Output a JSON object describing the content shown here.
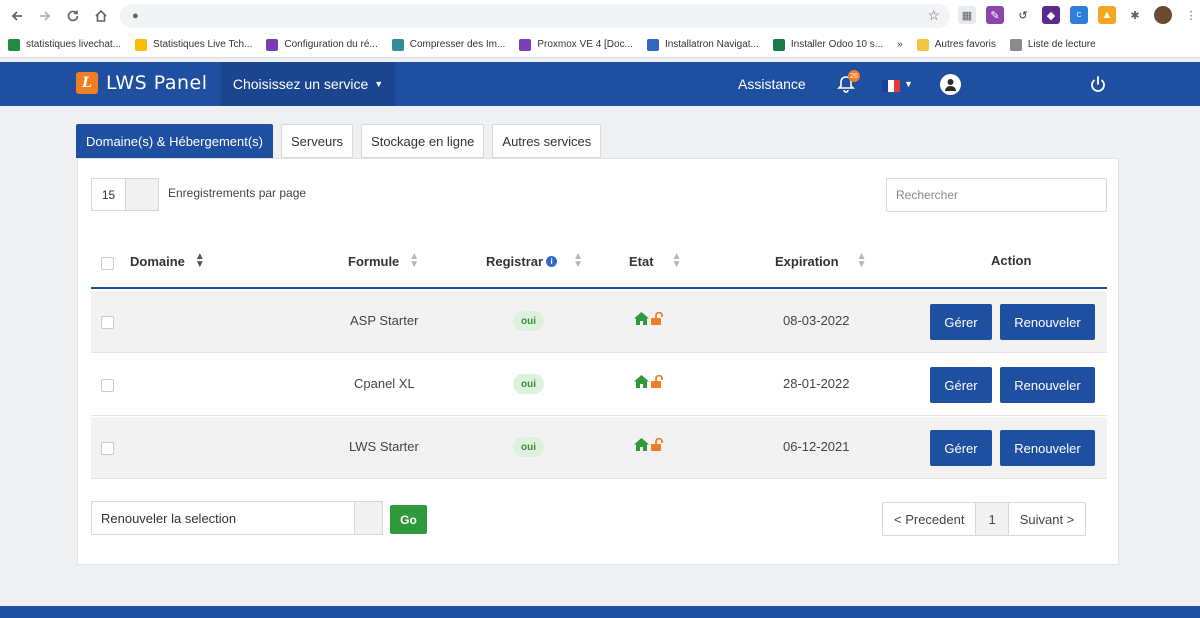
{
  "browser": {
    "bookmarks": [
      {
        "label": "statistiques livechat...",
        "color": "#1e8e3e"
      },
      {
        "label": "Statistiques Live Tch...",
        "color": "#fbbc04"
      },
      {
        "label": "Configuration du ré...",
        "color": "#7b3fb5"
      },
      {
        "label": "Compresser des Im...",
        "color": "#2f8e9a"
      },
      {
        "label": "Proxmox VE 4 [Doc...",
        "color": "#7b3fb5"
      },
      {
        "label": "Installatron Navigat...",
        "color": "#3068c6"
      },
      {
        "label": "Installer Odoo 10 s...",
        "color": "#1a7a4c"
      },
      {
        "label": "»",
        "color": ""
      },
      {
        "label": "Autres favoris",
        "color": "#f5c242"
      },
      {
        "label": "Liste de lecture",
        "color": "#8a8a8a"
      }
    ]
  },
  "topbar": {
    "logo_text": "LWS Panel",
    "service_menu": "Choisissez un service",
    "assistance": "Assistance",
    "bell_count": "26",
    "colors": {
      "bar": "#1f4fa0",
      "accent": "#f07e22"
    }
  },
  "tabs": [
    {
      "label": "Domaine(s) & Hébergement(s)",
      "active": true
    },
    {
      "label": "Serveurs",
      "active": false
    },
    {
      "label": "Stockage en ligne",
      "active": false
    },
    {
      "label": "Autres services",
      "active": false
    }
  ],
  "table_controls": {
    "per_page_value": "15",
    "per_page_label": "Enregistrements par page",
    "search_placeholder": "Rechercher"
  },
  "table": {
    "headers": {
      "domain": "Domaine",
      "formula": "Formule",
      "registrar": "Registrar",
      "state": "Etat",
      "expiration": "Expiration",
      "action": "Action"
    },
    "rows": [
      {
        "formula": "ASP Starter",
        "registrar": "oui",
        "expiration": "08-03-2022",
        "manage": "Gérer",
        "renew": "Renouveler"
      },
      {
        "formula": "Cpanel XL",
        "registrar": "oui",
        "expiration": "28-01-2022",
        "manage": "Gérer",
        "renew": "Renouveler"
      },
      {
        "formula": "LWS Starter",
        "registrar": "oui",
        "expiration": "06-12-2021",
        "manage": "Gérer",
        "renew": "Renouveler"
      }
    ]
  },
  "bulk": {
    "select_value": "Renouveler la selection",
    "go_label": "Go"
  },
  "pager": {
    "prev": "< Precedent",
    "current": "1",
    "next": "Suivant >"
  }
}
